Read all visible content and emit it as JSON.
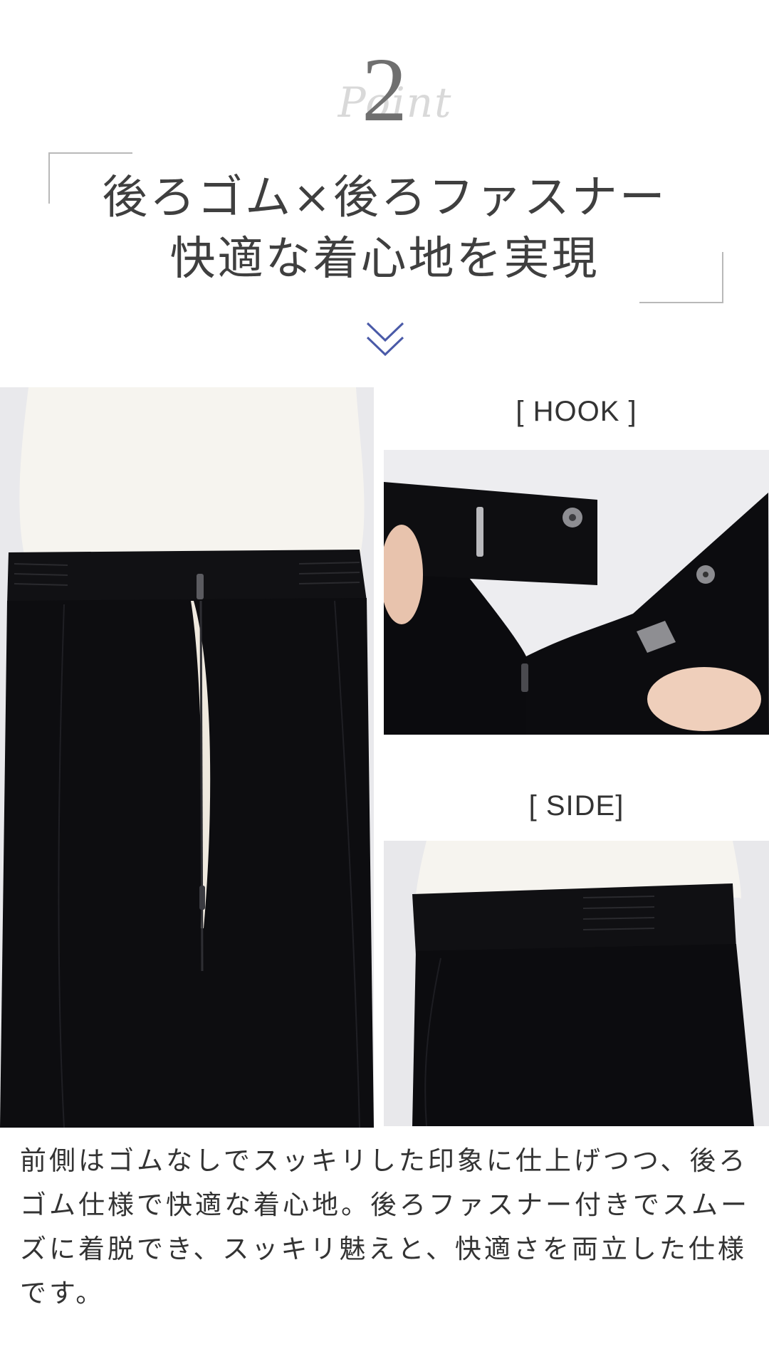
{
  "header": {
    "point_script": "Point",
    "point_number": "2",
    "title_line1": "後ろゴム×後ろファスナー",
    "title_line2": "快適な着心地を実現"
  },
  "labels": {
    "hook": "[ HOOK ]",
    "side": "[ SIDE]"
  },
  "description": {
    "line1": "前側はゴムなしでスッキリした印象に仕上げつつ、後ろ",
    "line2": "ゴム仕様で快適な着心地。後ろファスナー付きでスムー",
    "line3": "ズに着脱でき、スッキリ魅えと、快適さを両立した仕様",
    "line4": "です。"
  },
  "colors": {
    "accent": "#4a5aa8",
    "fabric": "#0e0e10"
  }
}
